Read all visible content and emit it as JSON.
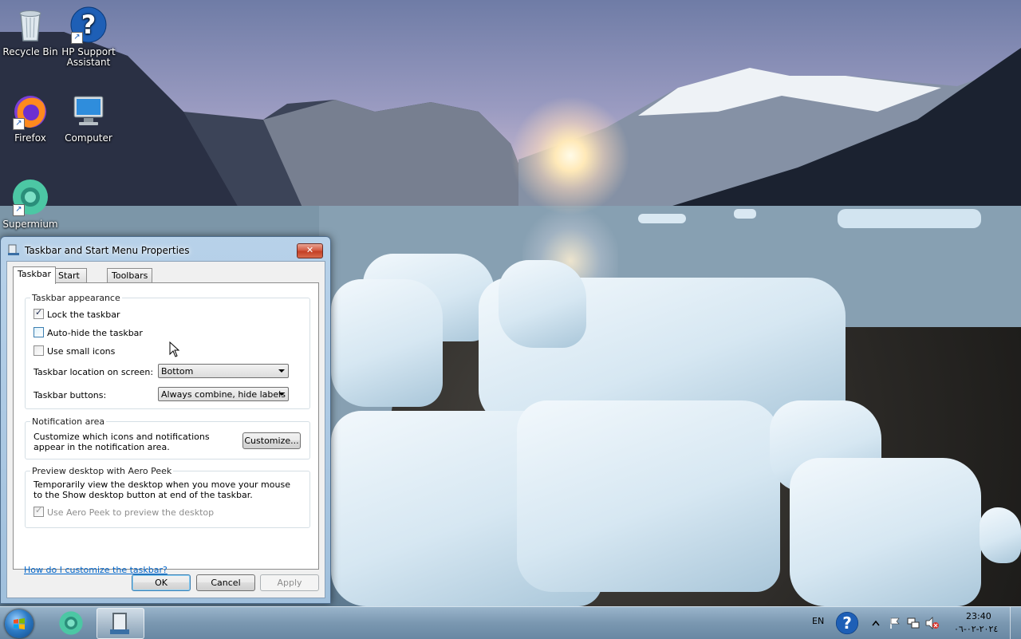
{
  "desktop": {
    "icons": [
      {
        "label": "Recycle Bin",
        "icon": "recycle-bin-icon"
      },
      {
        "label": "HP Support Assistant",
        "icon": "hp-support-icon"
      },
      {
        "label": "Firefox",
        "icon": "firefox-icon"
      },
      {
        "label": "Computer",
        "icon": "computer-icon"
      },
      {
        "label": "Supermium",
        "icon": "supermium-icon"
      }
    ]
  },
  "dialog": {
    "title": "Taskbar and Start Menu Properties",
    "close_glyph": "✕",
    "tabs": [
      "Taskbar",
      "Start Menu",
      "Toolbars"
    ],
    "active_tab": "Taskbar",
    "appearance": {
      "group_label": "Taskbar appearance",
      "lock": {
        "label": "Lock the taskbar",
        "checked": true
      },
      "autohide": {
        "label": "Auto-hide the taskbar",
        "checked": false
      },
      "small_icons": {
        "label": "Use small icons",
        "checked": false
      },
      "location_label": "Taskbar location on screen:",
      "location_value": "Bottom",
      "buttons_label": "Taskbar buttons:",
      "buttons_value": "Always combine, hide labels"
    },
    "notification": {
      "group_label": "Notification area",
      "description": "Customize which icons and notifications appear in the notification area.",
      "customize_label": "Customize..."
    },
    "aero_peek": {
      "group_label": "Preview desktop with Aero Peek",
      "description": "Temporarily view the desktop when you move your mouse to the Show desktop button at end of the taskbar.",
      "checkbox_label": "Use Aero Peek to preview the desktop",
      "checked": true,
      "enabled": false
    },
    "help_link": "How do I customize the taskbar?",
    "buttons": {
      "ok": "OK",
      "cancel": "Cancel",
      "apply": "Apply"
    }
  },
  "taskbar": {
    "language": "EN",
    "time": "23:40",
    "date": "٢٠٢٤-٠٢-٠٦",
    "pinned": [
      "windows-start-icon",
      "supermium-icon",
      "taskbar-properties-icon"
    ]
  },
  "colors": {
    "link": "#0066cc",
    "close_button": "#c33f25",
    "dialog_frame": "#a2c2df",
    "taskbar": "#7694ae"
  }
}
